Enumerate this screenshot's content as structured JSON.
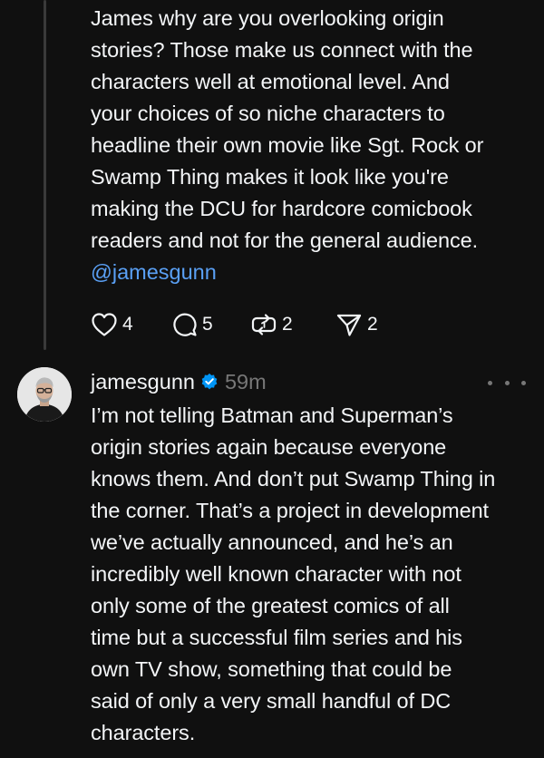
{
  "parent_post": {
    "text": "James why are you overlooking origin\nstories? Those make us connect with the\ncharacters well at emotional level. And\nyour choices of so niche characters to\nheadline their own movie like Sgt. Rock or\nSwamp Thing makes it look like you're\nmaking the DCU for hardcore comicbook\nreaders and not for the general audience.",
    "mention": "@jamesgunn",
    "actions": {
      "likes": "4",
      "replies": "5",
      "reposts": "2",
      "shares": "2"
    }
  },
  "reply_post": {
    "username": "jamesgunn",
    "verified": true,
    "timestamp": "59m",
    "text": "I’m not telling Batman and Superman’s\norigin stories again because everyone\nknows them. And don’t put Swamp Thing in\nthe corner. That’s a project in development\nwe’ve actually announced, and he’s an\nincredibly well known character with not\nonly some of the greatest comics of all\ntime but a successful film series and his\nown TV show, something that could be\nsaid of only a very small handful of DC\ncharacters."
  },
  "icons": [
    "heart-icon",
    "comment-icon",
    "repost-icon",
    "send-icon",
    "verified-badge-icon",
    "more-options-icon"
  ],
  "colors": {
    "background": "#101010",
    "text": "#f3f5f7",
    "muted": "#777777",
    "link": "#5aa0f5",
    "verified": "#0095f6",
    "thread_line": "#3a3a3a"
  }
}
